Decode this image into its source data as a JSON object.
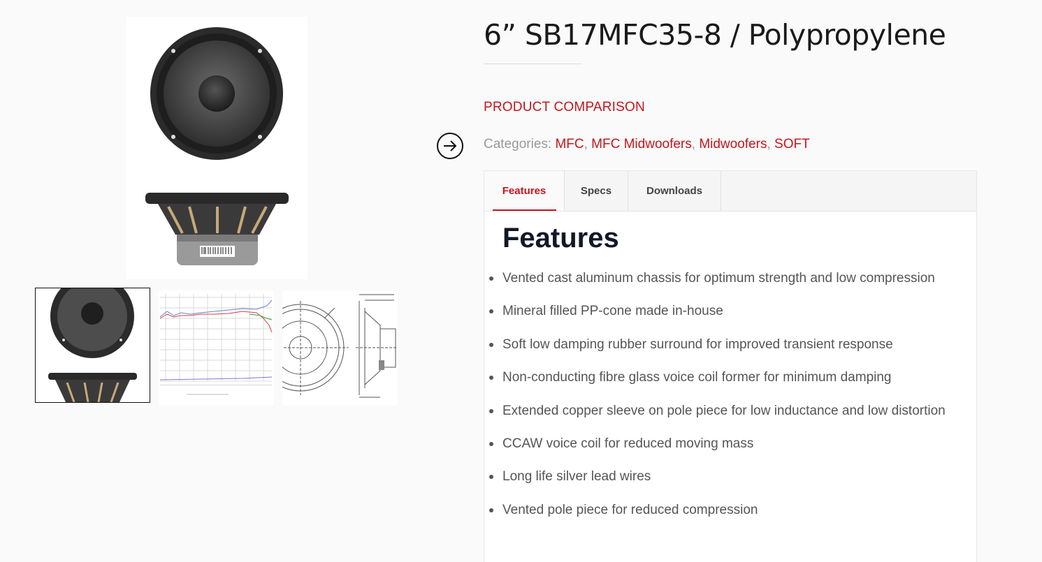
{
  "product": {
    "title": "6” SB17MFC35-8 / Polypropylene",
    "compare_label": "PRODUCT COMPARISON",
    "categories_label": "Categories:",
    "categories": [
      "MFC",
      "MFC Midwoofers",
      "Midwoofers",
      "SOFT"
    ]
  },
  "gallery": {
    "thumbnails": [
      "speaker-photo-thumbnail",
      "frequency-response-thumbnail",
      "technical-drawing-thumbnail"
    ]
  },
  "tabs": [
    {
      "label": "Features",
      "active": true
    },
    {
      "label": "Specs",
      "active": false
    },
    {
      "label": "Downloads",
      "active": false
    }
  ],
  "features": {
    "heading": "Features",
    "items": [
      "Vented cast aluminum chassis for optimum strength and low compression",
      "Mineral filled PP-cone made in-house",
      "Soft low damping rubber surround for improved transient response",
      "Non-conducting fibre glass voice coil former for minimum damping",
      "Extended copper sleeve on pole piece for low inductance and low distortion",
      "CCAW voice coil for reduced moving mass",
      "Long life silver lead wires",
      "Vented pole piece for reduced compression"
    ]
  },
  "colors": {
    "accent": "#c4161c",
    "muted_text": "#999999",
    "body_text": "#555555",
    "heading": "#111827"
  },
  "icons": {
    "nav": "arrow-right-circle-icon"
  }
}
